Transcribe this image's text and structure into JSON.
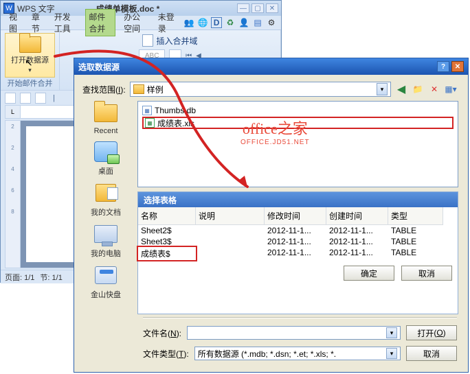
{
  "wps": {
    "app_label": "WPS 文字",
    "app_icon_text": "W",
    "doc_name": "成绩单模板.doc *",
    "tabs": [
      "视图",
      "章节",
      "开发工具",
      "邮件合并",
      "办公空间",
      "未登录"
    ],
    "active_tab_index": 3,
    "ribbon": {
      "open_ds": "打开数据源",
      "insert_field": "插入合并域",
      "start_mailmerge": "开始邮件合并",
      "abc_box": "ABC",
      "box_d": "D"
    },
    "status": {
      "page": "页面: 1/1",
      "section": "节: 1/1"
    },
    "toolbar_icons": [
      "people-icon",
      "globe-icon",
      "d-icon",
      "refresh-icon",
      "person-icon",
      "bar-icon",
      "gear-icon"
    ]
  },
  "dialog": {
    "title": "选取数据源",
    "lookin_label": "查找范围",
    "lookin_key": "I",
    "lookin_value": "样例",
    "toolbar_icons": [
      "back-icon",
      "up-icon",
      "delete-icon",
      "views-icon"
    ],
    "side": [
      {
        "label": "Recent",
        "icon": "folder"
      },
      {
        "label": "桌面",
        "icon": "desktop"
      },
      {
        "label": "我的文档",
        "icon": "doc"
      },
      {
        "label": "我的电脑",
        "icon": "pc"
      },
      {
        "label": "金山快盘",
        "icon": "disk"
      }
    ],
    "files": [
      {
        "name": "Thumbs.db",
        "type": "db"
      },
      {
        "name": "成绩表.xls",
        "type": "xls",
        "selected": true
      }
    ],
    "table": {
      "title": "选择表格",
      "cols": [
        "名称",
        "说明",
        "修改时间",
        "创建时间",
        "类型"
      ],
      "rows": [
        {
          "c": [
            "Sheet2$",
            "",
            "2012-11-1...",
            "2012-11-1...",
            "TABLE"
          ]
        },
        {
          "c": [
            "Sheet3$",
            "",
            "2012-11-1...",
            "2012-11-1...",
            "TABLE"
          ]
        },
        {
          "c": [
            "成绩表$",
            "",
            "2012-11-1...",
            "2012-11-1...",
            "TABLE"
          ],
          "selected": true
        }
      ],
      "ok": "确定",
      "cancel": "取消"
    },
    "filename_label": "文件名",
    "filename_key": "N",
    "filename_value": "",
    "filetype_label": "文件类型",
    "filetype_key": "T",
    "filetype_value": "所有数据源 (*.mdb; *.dsn; *.et; *.xls; *.",
    "open_btn": "打开",
    "open_key": "O",
    "cancel_btn": "取消"
  },
  "watermark": {
    "line1": "office之家",
    "line2": "OFFICE.JD51.NET"
  },
  "ruler_marks": [
    "2",
    "",
    "2",
    "4",
    "6",
    "8"
  ]
}
